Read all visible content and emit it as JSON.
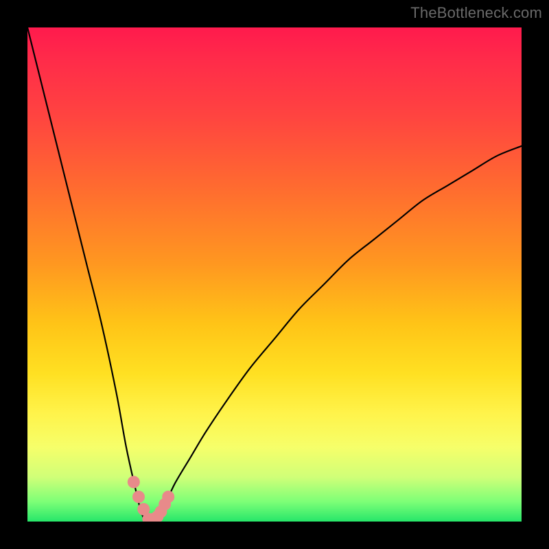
{
  "watermark": "TheBottleneck.com",
  "chart_data": {
    "type": "line",
    "title": "",
    "xlabel": "",
    "ylabel": "",
    "xlim": [
      0,
      100
    ],
    "ylim": [
      0,
      100
    ],
    "notes": "Single V-shaped bottleneck curve over a red-to-green vertical gradient. X appears to be a component balance parameter (percent); Y is bottleneck severity (percent, 0 = no bottleneck). Minimum sits near x ≈ 24 at y ≈ 0. Right branch tops out near y ≈ 76 at x = 100.",
    "series": [
      {
        "name": "bottleneck-curve",
        "x": [
          0,
          3,
          6,
          9,
          12,
          15,
          18,
          20,
          22,
          23,
          24,
          25,
          26,
          28,
          30,
          33,
          36,
          40,
          45,
          50,
          55,
          60,
          65,
          70,
          75,
          80,
          85,
          90,
          95,
          100
        ],
        "values": [
          100,
          88,
          76,
          64,
          52,
          40,
          26,
          15,
          6,
          2,
          0,
          0.5,
          1.5,
          4,
          8,
          13,
          18,
          24,
          31,
          37,
          43,
          48,
          53,
          57,
          61,
          65,
          68,
          71,
          74,
          76
        ]
      }
    ],
    "markers": {
      "name": "valley-dots",
      "color": "#e88a8a",
      "x": [
        21.5,
        22.5,
        23.5,
        24.5,
        25.5,
        27.0,
        27.8,
        26.3,
        28.5
      ],
      "y": [
        8,
        5,
        2.5,
        0.5,
        0.5,
        2,
        3.5,
        1,
        5
      ]
    },
    "background_gradient": {
      "top": "#ff1a4d",
      "mid": "#ffe022",
      "bottom": "#26e66a"
    }
  }
}
